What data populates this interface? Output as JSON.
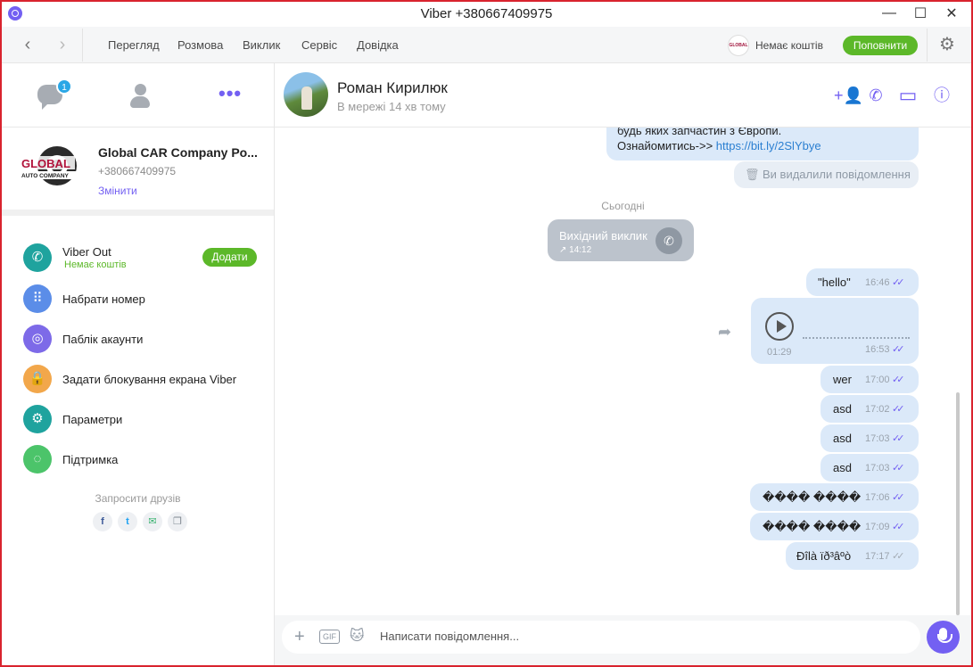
{
  "window": {
    "title": "Viber +380667409975",
    "minimize": "—",
    "maximize": "☐",
    "close": "✕"
  },
  "menu": {
    "back": "‹",
    "forward": "›",
    "items": [
      "Перегляд",
      "Розмова",
      "Виклик",
      "Сервіс",
      "Довідка"
    ],
    "credit_logo": "GLOBAL",
    "credit": "Немає коштів",
    "topup": "Поповнити",
    "settings_icon": "⚙"
  },
  "sidebar": {
    "chats_badge": "1",
    "more": "•••",
    "profile": {
      "logo_text_1": "GLOBAL",
      "logo_text_2": "AUTO COMPANY",
      "name": "Global CAR Company Po...",
      "phone": "+380667409975",
      "edit": "Змінити"
    },
    "items": [
      {
        "label": "Viber Out",
        "sub": "Немає коштів",
        "button": "Додати",
        "icon": "phone-out-icon",
        "glyph": "✆",
        "color": "#1fa39e"
      },
      {
        "label": "Набрати номер",
        "icon": "dialpad-icon",
        "glyph": "⠿",
        "color": "#5b8de8"
      },
      {
        "label": "Паблік акаунти",
        "icon": "public-accounts-icon",
        "glyph": "◎",
        "color": "#7d6ae8"
      },
      {
        "label": "Задати блокування екрана Viber",
        "icon": "lock-icon",
        "glyph": "🔒",
        "color": "#f2a74b"
      },
      {
        "label": "Параметри",
        "icon": "gear-icon",
        "glyph": "⚙",
        "color": "#1fa39e"
      },
      {
        "label": "Підтримка",
        "icon": "support-icon",
        "glyph": "◌",
        "color": "#4cc46a"
      }
    ],
    "invite": "Запросити друзів",
    "social": [
      {
        "icon": "facebook-icon",
        "glyph": "f",
        "color": "#3b5998"
      },
      {
        "icon": "twitter-icon",
        "glyph": "t",
        "color": "#1da1f2"
      },
      {
        "icon": "email-icon",
        "glyph": "✉",
        "color": "#3cb371"
      },
      {
        "icon": "copy-icon",
        "glyph": "❐",
        "color": "#7f8790"
      }
    ]
  },
  "chat": {
    "contact_name": "Роман Кирилюк",
    "status": "В мережі 14 хв тому",
    "header_icons": {
      "add_participant": "+👤",
      "call": "✆",
      "video": "▭",
      "info": "ⓘ"
    },
    "partial_message": {
      "line1": "будь яких запчастин з Європи.",
      "line2_prefix": "Ознайомитись->> ",
      "link": "https://bit.ly/2SlYbye"
    },
    "deleted_notice": "Ви видалили повідомлення",
    "date_separator": "Сьогодні",
    "call": {
      "title": "Вихідний виклик",
      "time": "↗ 14:12",
      "phone": "✆"
    },
    "messages": [
      {
        "text": "\"hello\"",
        "time": "16:46",
        "status": "read"
      },
      {
        "type": "voice",
        "duration": "01:29",
        "time": "16:53",
        "status": "read",
        "forward": "➦"
      },
      {
        "text": "wer",
        "time": "17:00",
        "status": "read"
      },
      {
        "text": "asd",
        "time": "17:02",
        "status": "read"
      },
      {
        "text": "asd",
        "time": "17:03",
        "status": "read"
      },
      {
        "text": "asd",
        "time": "17:03",
        "status": "read"
      },
      {
        "text": "���� ����",
        "time": "17:06",
        "status": "read"
      },
      {
        "text": "���� ����",
        "time": "17:09",
        "status": "read"
      },
      {
        "text": "Ðîlà ïð³âºò",
        "time": "17:17",
        "status": "delivered"
      }
    ],
    "tick_glyph": "✓✓"
  },
  "composer": {
    "placeholder": "Написати повідомлення...",
    "add": "+",
    "gif": "GIF",
    "sticker": "🐱"
  }
}
